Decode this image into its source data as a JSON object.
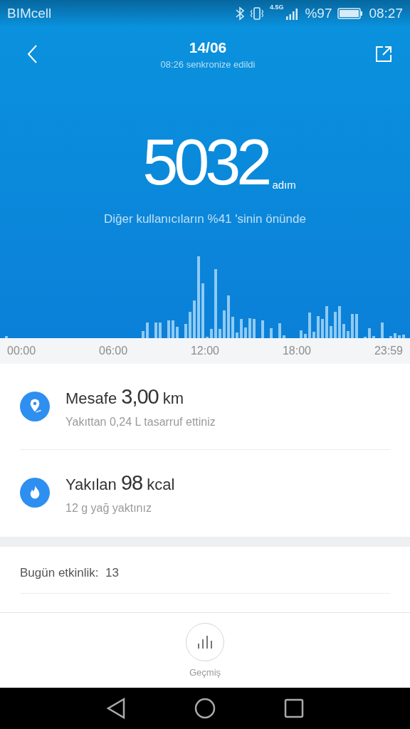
{
  "status_bar": {
    "carrier": "BIMcell",
    "network": "4.5G",
    "battery": "%97",
    "time": "08:27"
  },
  "header": {
    "title": "14/06",
    "subtitle": "08:26 senkronize edildi"
  },
  "steps": {
    "value": "5032",
    "unit": "adım",
    "comparison": "Diğer kullanıcıların %41 'sinin önünde"
  },
  "chart_axis": [
    "00:00",
    "06:00",
    "12:00",
    "18:00",
    "23:59"
  ],
  "stats": [
    {
      "kind": "distance",
      "label": "Mesafe",
      "value": "3,00",
      "unit": "km",
      "note": "Yakıttan 0,24 L tasarruf ettiniz"
    },
    {
      "kind": "calories",
      "label": "Yakılan",
      "value": "98",
      "unit": "kcal",
      "note": "12 g yağ yaktınız"
    }
  ],
  "activity": {
    "label": "Bugün etkinlik:",
    "value": "13"
  },
  "history_button": {
    "label": "Geçmiş"
  }
}
